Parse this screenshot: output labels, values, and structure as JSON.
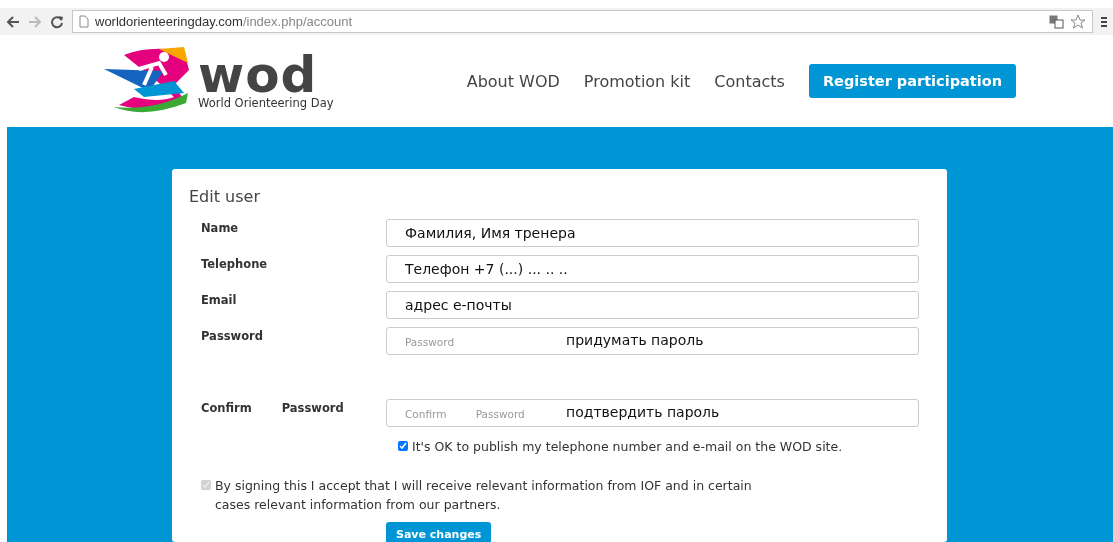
{
  "browser": {
    "url_host": "worldorienteeringday.com",
    "url_path": "/index.php/account"
  },
  "header": {
    "logo_mark": "wod",
    "logo_caption": "World Orienteering Day",
    "nav": [
      {
        "label": "About WOD",
        "kind": "link"
      },
      {
        "label": "Promotion kit",
        "kind": "link"
      },
      {
        "label": "Contacts",
        "kind": "link"
      },
      {
        "label": "Register participation",
        "kind": "button"
      }
    ]
  },
  "form": {
    "title": "Edit user",
    "fields": [
      {
        "label": "Name",
        "value": "Фамилия, Имя тренера"
      },
      {
        "label": "Telephone",
        "value": "Телефон +7 (...) ... .. .."
      },
      {
        "label": "Email",
        "value": "адрес е-почты"
      },
      {
        "label": "Password",
        "placeholder": "Password",
        "note": "придумать пароль"
      },
      {
        "label": "Confirm Password",
        "placeholder": "Confirm Password",
        "note": "подтвердить пароль"
      }
    ],
    "checkboxes": [
      {
        "label": "It's OK to publish my telephone number and e-mail on the WOD site.",
        "checked": true,
        "disabled": false
      },
      {
        "label": "By signing this I accept that I will receive relevant information from IOF and in certain cases relevant information from our partners.",
        "checked": true,
        "disabled": true
      }
    ],
    "submit": "Save changes"
  }
}
